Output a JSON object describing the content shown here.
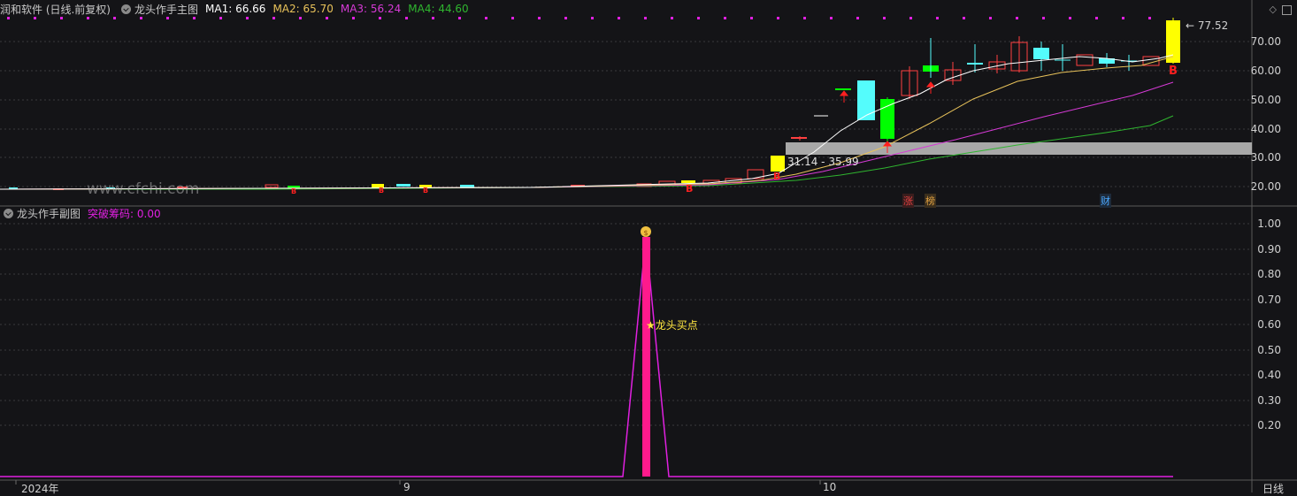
{
  "header": {
    "app": "润和软件 (日线.前复权)",
    "indicator": "龙头作手主图",
    "ma": [
      {
        "label": "MA1: 66.66",
        "color": "#ffffff"
      },
      {
        "label": "MA2: 65.70",
        "color": "#e8c25a"
      },
      {
        "label": "MA3: 56.24",
        "color": "#d63ad6"
      },
      {
        "label": "MA4: 44.60",
        "color": "#2fb52f"
      }
    ]
  },
  "sub_header": {
    "indicator": "龙头作手副图",
    "value_label": "突破筹码: 0.00"
  },
  "main_axis": {
    "ticks": [
      "70.00",
      "60.00",
      "50.00",
      "40.00",
      "30.00",
      "20.00"
    ],
    "max_label": "77.52"
  },
  "sub_axis": {
    "ticks": [
      "1.00",
      "0.90",
      "0.80",
      "0.70",
      "0.60",
      "0.50",
      "0.40",
      "0.30",
      "0.20"
    ]
  },
  "x_axis": {
    "labels": [
      "2024年",
      "9",
      "10"
    ],
    "period": "日线"
  },
  "annotations": {
    "band_label": "31.14 - 35.99",
    "buy_label": "★龙头买点",
    "watermark": "www.cfchi.com",
    "tags": [
      {
        "text": "涨",
        "color": "#e04040"
      },
      {
        "text": "榜",
        "color": "#e0a040"
      },
      {
        "text": "财",
        "color": "#4aa8ff"
      }
    ],
    "b_marker": "B"
  },
  "colors": {
    "up": "#ff4040",
    "down": "#54fcfc",
    "signal_yellow": "#ffff00",
    "signal_green": "#00ff00",
    "ma1": "#ffffff",
    "ma2": "#e8c25a",
    "ma3": "#d63ad6",
    "ma4": "#2fb52f",
    "sub_line": "#e020e0",
    "sub_bar": "#ff1a8c"
  }
}
